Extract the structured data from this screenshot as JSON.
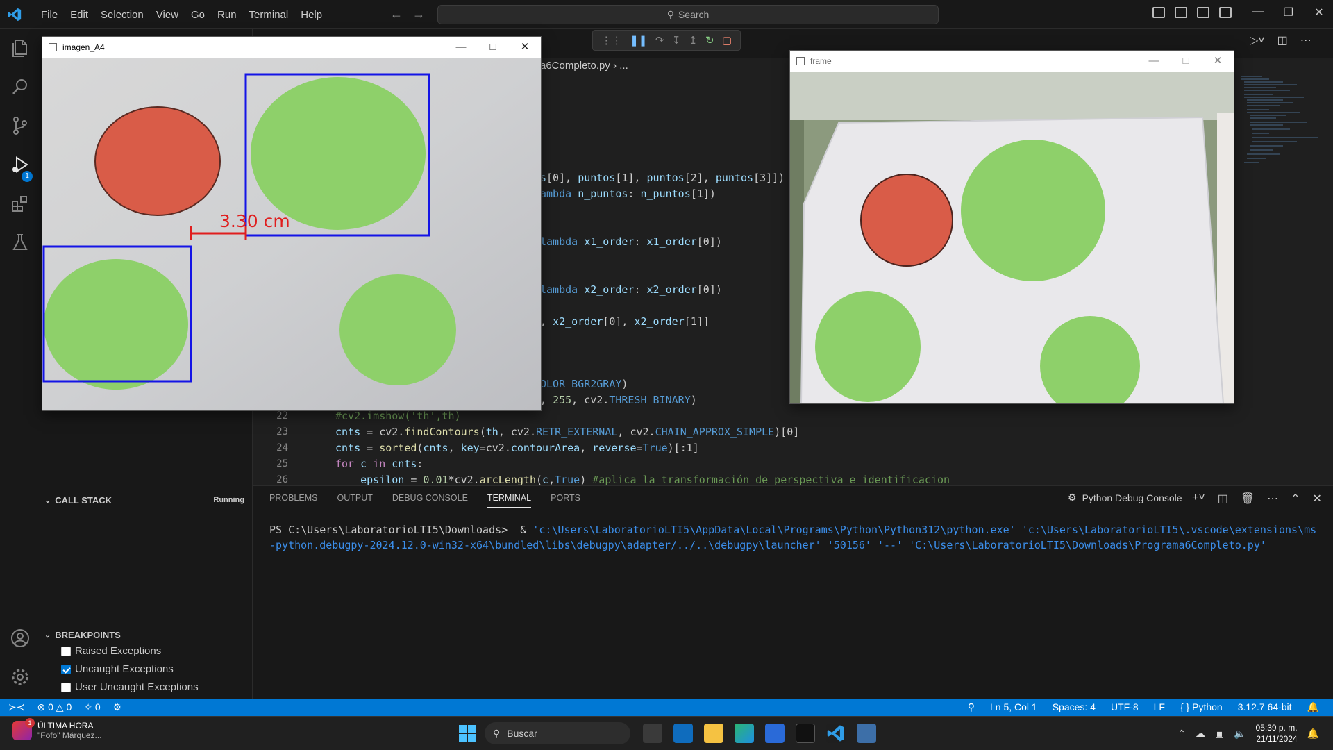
{
  "menu": [
    "File",
    "Edit",
    "Selection",
    "View",
    "Go",
    "Run",
    "Terminal",
    "Help"
  ],
  "search": {
    "label": "Search"
  },
  "editor": {
    "breadcrumb": "a6Completo.py",
    "breadcrumb_more": "...",
    "code": [
      {
        "ln": "",
        "parts": [
          [
            "var",
            "s"
          ],
          [
            "",
            "[0], "
          ],
          [
            "var",
            "puntos"
          ],
          [
            "",
            "[1], "
          ],
          [
            "var",
            "puntos"
          ],
          [
            "",
            "[2], "
          ],
          [
            "var",
            "puntos"
          ],
          [
            "",
            "[3]])"
          ]
        ]
      },
      {
        "ln": "",
        "parts": [
          [
            "cst",
            "ambda "
          ],
          [
            "var",
            "n_puntos"
          ],
          [
            "",
            ": "
          ],
          [
            "var",
            "n_puntos"
          ],
          [
            "",
            "[1])"
          ]
        ]
      },
      {
        "ln": "",
        "parts": [
          [
            "cst",
            "lambda "
          ],
          [
            "var",
            "x1_order"
          ],
          [
            "",
            ": "
          ],
          [
            "var",
            "x1_order"
          ],
          [
            "",
            "[0])"
          ]
        ]
      },
      {
        "ln": "",
        "parts": [
          [
            "cst",
            "lambda "
          ],
          [
            "var",
            "x2_order"
          ],
          [
            "",
            ": "
          ],
          [
            "var",
            "x2_order"
          ],
          [
            "",
            "[0])"
          ]
        ]
      },
      {
        "ln": "",
        "parts": [
          [
            "",
            ", "
          ],
          [
            "var",
            "x2_order"
          ],
          [
            "",
            "[0], "
          ],
          [
            "var",
            "x2_order"
          ],
          [
            "",
            "[1]]"
          ]
        ]
      },
      {
        "ln": "",
        "parts": [
          [
            "cst",
            "OLOR_BGR2GRAY"
          ],
          [
            "",
            ")"
          ]
        ]
      },
      {
        "ln": "",
        "parts": [
          [
            "",
            ", "
          ],
          [
            "num",
            "255"
          ],
          [
            "",
            ", cv2."
          ],
          [
            "cst",
            "THRESH_BINARY"
          ],
          [
            "",
            ")"
          ]
        ]
      },
      {
        "ln": "22",
        "parts": [
          [
            "cm",
            "#cv2.imshow('th',th)"
          ]
        ]
      },
      {
        "ln": "23",
        "parts": [
          [
            "var",
            "cnts"
          ],
          [
            "",
            " = cv2."
          ],
          [
            "fn",
            "findContours"
          ],
          [
            "",
            "("
          ],
          [
            "var",
            "th"
          ],
          [
            "",
            ", cv2."
          ],
          [
            "cst",
            "RETR_EXTERNAL"
          ],
          [
            "",
            ", cv2."
          ],
          [
            "cst",
            "CHAIN_APPROX_SIMPLE"
          ],
          [
            "",
            ")[0]"
          ]
        ]
      },
      {
        "ln": "24",
        "parts": [
          [
            "var",
            "cnts"
          ],
          [
            "",
            " = "
          ],
          [
            "fn",
            "sorted"
          ],
          [
            "",
            "("
          ],
          [
            "var",
            "cnts"
          ],
          [
            "",
            ", "
          ],
          [
            "var",
            "key"
          ],
          [
            "",
            "=cv2."
          ],
          [
            "var",
            "contourArea"
          ],
          [
            "",
            ", "
          ],
          [
            "var",
            "reverse"
          ],
          [
            "",
            "="
          ],
          [
            "cst",
            "True"
          ],
          [
            "",
            ")[:1]"
          ]
        ]
      },
      {
        "ln": "25",
        "parts": [
          [
            "kw",
            "for"
          ],
          [
            "",
            " "
          ],
          [
            "var",
            "c"
          ],
          [
            "",
            " "
          ],
          [
            "kw",
            "in"
          ],
          [
            "",
            " "
          ],
          [
            "var",
            "cnts"
          ],
          [
            "",
            ":"
          ]
        ]
      },
      {
        "ln": "26",
        "parts": [
          [
            "",
            "    "
          ],
          [
            "var",
            "epsilon"
          ],
          [
            "",
            " = "
          ],
          [
            "num",
            "0.01"
          ],
          [
            "",
            "*cv2."
          ],
          [
            "fn",
            "arcLength"
          ],
          [
            "",
            "("
          ],
          [
            "var",
            "c"
          ],
          [
            "",
            ","
          ],
          [
            "cst",
            "True"
          ],
          [
            "",
            ") "
          ],
          [
            "cm",
            "#aplica la transformación de perspectiva e identificacion"
          ]
        ]
      }
    ]
  },
  "sidebar": {
    "call_stack": {
      "title": "CALL STACK",
      "status": "Running"
    },
    "breakpoints": {
      "title": "BREAKPOINTS",
      "items": [
        {
          "label": "Raised Exceptions",
          "checked": false
        },
        {
          "label": "Uncaught Exceptions",
          "checked": true
        },
        {
          "label": "User Uncaught Exceptions",
          "checked": false
        }
      ]
    }
  },
  "activity": {
    "debug_badge": "1"
  },
  "panel": {
    "tabs": [
      "PROBLEMS",
      "OUTPUT",
      "DEBUG CONSOLE",
      "TERMINAL",
      "PORTS"
    ],
    "active_tab": "TERMINAL",
    "console_label": "Python Debug Console",
    "terminal": {
      "prompt": "PS C:\\Users\\LaboratorioLTI5\\Downloads>",
      "amp": "&",
      "cmd": "'c:\\Users\\LaboratorioLTI5\\AppData\\Local\\Programs\\Python\\Python312\\python.exe' 'c:\\Users\\LaboratorioLTI5\\.vscode\\extensions\\ms-python.debugpy-2024.12.0-win32-x64\\bundled\\libs\\debugpy\\adapter/../..\\debugpy\\launcher' '50156' '--' 'C:\\Users\\LaboratorioLTI5\\Downloads\\Programa6Completo.py'"
    }
  },
  "status": {
    "errors": "0",
    "warnings": "0",
    "ports": "0",
    "position": "Ln 5, Col 1",
    "spaces": "Spaces: 4",
    "encoding": "UTF-8",
    "eol": "LF",
    "language": "Python",
    "interpreter": "3.12.7 64-bit"
  },
  "win_a4": {
    "title": "imagen_A4",
    "measurement": "3.30 cm"
  },
  "win_frame": {
    "title": "frame"
  },
  "taskbar": {
    "news_badge": "1",
    "news_title": "ÚLTIMA HORA",
    "news_sub": "\"Fofo\" Márquez...",
    "search_placeholder": "Buscar",
    "time": "05:39 p. m.",
    "date": "21/11/2024"
  },
  "colors": {
    "accent": "#0078d4",
    "box": "#1414e6",
    "measure": "#e01e1e",
    "green": "#8ed06a",
    "red": "#d95c48"
  }
}
